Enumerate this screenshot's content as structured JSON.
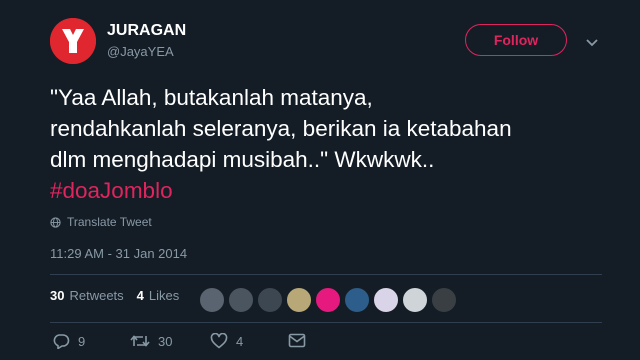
{
  "user": {
    "name": "JURAGAN",
    "handle": "@JayaYEA",
    "avatar_letter": "Y",
    "avatar_color": "#e0262e"
  },
  "follow_label": "Follow",
  "tweet": {
    "line1": "\"Yaa Allah, butakanlah matanya,",
    "line2": "rendahkanlah seleranya, berikan ia ketabahan",
    "line3": "dlm menghadapi musibah..\" Wkwkwk..",
    "hashtag": "#doaJomblo"
  },
  "translate_label": "Translate Tweet",
  "timestamp": "11:29 AM - 31 Jan 2014",
  "stats": {
    "retweets_count": "30",
    "retweets_label": "Retweets",
    "likes_count": "4",
    "likes_label": "Likes"
  },
  "liker_colors": [
    "#5a6470",
    "#4b5560",
    "#3c4752",
    "#b8a877",
    "#e6197f",
    "#2d5d8a",
    "#d9d4e8",
    "#cfd4d8",
    "#3a3f44"
  ],
  "actions": {
    "reply_count": "9",
    "retweet_count": "30",
    "like_count": "4"
  },
  "colors": {
    "background": "#141d26",
    "accent": "#e0245e",
    "muted": "#8899a6"
  },
  "icons": [
    "chevron-down-icon",
    "globe-icon",
    "reply-icon",
    "retweet-icon",
    "heart-icon",
    "message-icon"
  ]
}
